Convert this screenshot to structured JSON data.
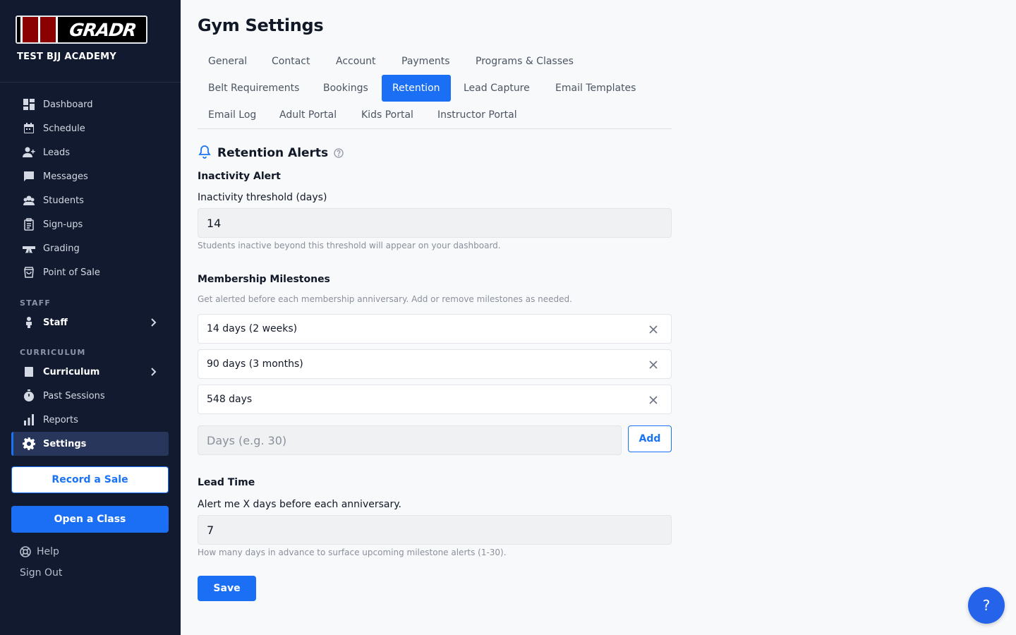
{
  "sidebar": {
    "logo_text": "GRADR",
    "gym_name": "TEST BJJ ACADEMY",
    "items": [
      {
        "label": "Dashboard",
        "icon": "dashboard-icon"
      },
      {
        "label": "Schedule",
        "icon": "calendar-icon"
      },
      {
        "label": "Leads",
        "icon": "person-add-icon"
      },
      {
        "label": "Messages",
        "icon": "chat-icon"
      },
      {
        "label": "Students",
        "icon": "students-icon"
      },
      {
        "label": "Sign-ups",
        "icon": "clipboard-icon"
      },
      {
        "label": "Grading",
        "icon": "belt-icon"
      },
      {
        "label": "Point of Sale",
        "icon": "shopping-bag-icon"
      }
    ],
    "staff_section": "STAFF",
    "staff_item": "Staff",
    "curriculum_section": "CURRICULUM",
    "curriculum_item": "Curriculum",
    "past_sessions": "Past Sessions",
    "reports": "Reports",
    "settings": "Settings",
    "record_sale": "Record a Sale",
    "open_class": "Open a Class",
    "help": "Help",
    "sign_out": "Sign Out"
  },
  "main": {
    "title": "Gym Settings",
    "tabs": [
      "General",
      "Contact",
      "Account",
      "Payments",
      "Programs & Classes",
      "Belt Requirements",
      "Bookings",
      "Retention",
      "Lead Capture",
      "Email Templates",
      "Email Log",
      "Adult Portal",
      "Kids Portal",
      "Instructor Portal"
    ],
    "active_tab": "Retention",
    "section_title": "Retention Alerts",
    "inactivity": {
      "heading": "Inactivity Alert",
      "label": "Inactivity threshold (days)",
      "value": "14",
      "help": "Students inactive beyond this threshold will appear on your dashboard."
    },
    "milestones": {
      "heading": "Membership Milestones",
      "help": "Get alerted before each membership anniversary. Add or remove milestones as needed.",
      "items": [
        "14 days (2 weeks)",
        "90 days (3 months)",
        "548 days"
      ],
      "input_placeholder": "Days (e.g. 30)",
      "add_label": "Add"
    },
    "lead_time": {
      "heading": "Lead Time",
      "label": "Alert me X days before each anniversary.",
      "value": "7",
      "help": "How many days in advance to surface upcoming milestone alerts (1-30)."
    },
    "save_label": "Save"
  },
  "fab_label": "?",
  "colors": {
    "sidebar_bg": "#111a2e",
    "accent": "#1a6ff5",
    "logo_red": "#8b0000"
  }
}
